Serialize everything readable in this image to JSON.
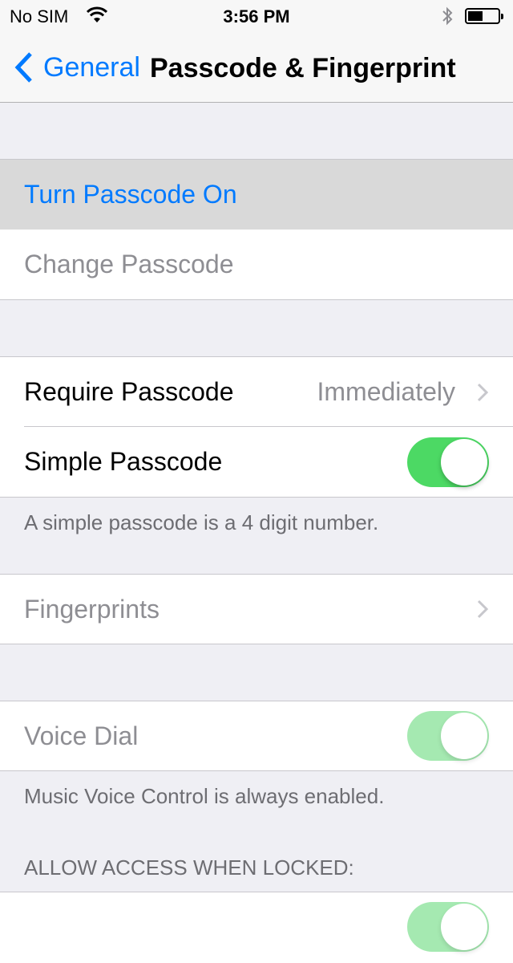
{
  "status_bar": {
    "carrier": "No SIM",
    "time": "3:56 PM",
    "wifi_icon": "wifi-icon",
    "bluetooth_icon": "bluetooth-icon",
    "battery_level": 0.5
  },
  "nav": {
    "back_label": "General",
    "title": "Passcode & Fingerprint"
  },
  "colors": {
    "accent": "#007aff",
    "toggle_on": "#4cd964",
    "toggle_on_disabled": "#a5e9b1",
    "background": "#efeff4"
  },
  "section1": {
    "turn_on": "Turn Passcode On",
    "change": "Change Passcode"
  },
  "section2": {
    "require_label": "Require Passcode",
    "require_value": "Immediately",
    "simple_label": "Simple Passcode",
    "simple_on": true,
    "footer": "A simple passcode is a 4 digit number."
  },
  "section3": {
    "fingerprints": "Fingerprints"
  },
  "section4": {
    "voice_dial": "Voice Dial",
    "voice_dial_on": true,
    "footer": "Music Voice Control is always enabled."
  },
  "section5": {
    "header": "ALLOW ACCESS WHEN LOCKED:"
  }
}
